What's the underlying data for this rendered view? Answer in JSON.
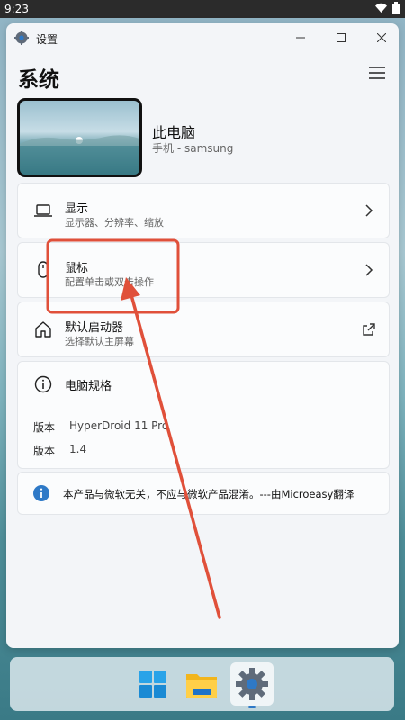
{
  "status_bar": {
    "time": "9:23"
  },
  "window": {
    "title": "设置"
  },
  "page": {
    "title": "系统"
  },
  "device": {
    "name": "此电脑",
    "subtitle": "手机 - samsung"
  },
  "settings": [
    {
      "title": "显示",
      "subtitle": "显示器、分辨率、缩放",
      "icon": "laptop-icon",
      "trailing": "chevron-right-icon"
    },
    {
      "title": "鼠标",
      "subtitle": "配置单击或双击操作",
      "icon": "mouse-icon",
      "trailing": "chevron-right-icon"
    },
    {
      "title": "默认启动器",
      "subtitle": "选择默认主屏幕",
      "icon": "home-icon",
      "trailing": "open-external-icon"
    }
  ],
  "specs": {
    "title": "电脑规格",
    "icon": "info-icon",
    "rows": [
      {
        "label": "版本",
        "value": "HyperDroid 11 Pro"
      },
      {
        "label": "版本",
        "value": "1.4"
      }
    ]
  },
  "notice": {
    "text": "本产品与微软无关，不应与微软产品混淆。---由Microeasy翻译",
    "icon": "info-filled-icon"
  },
  "taskbar": {
    "items": [
      {
        "name": "start-icon"
      },
      {
        "name": "file-explorer-icon"
      },
      {
        "name": "settings-app-icon",
        "active": true
      }
    ]
  },
  "colors": {
    "accent": "#2e79c7",
    "annotation": "#e0503a",
    "background": "#f3f5f8"
  }
}
